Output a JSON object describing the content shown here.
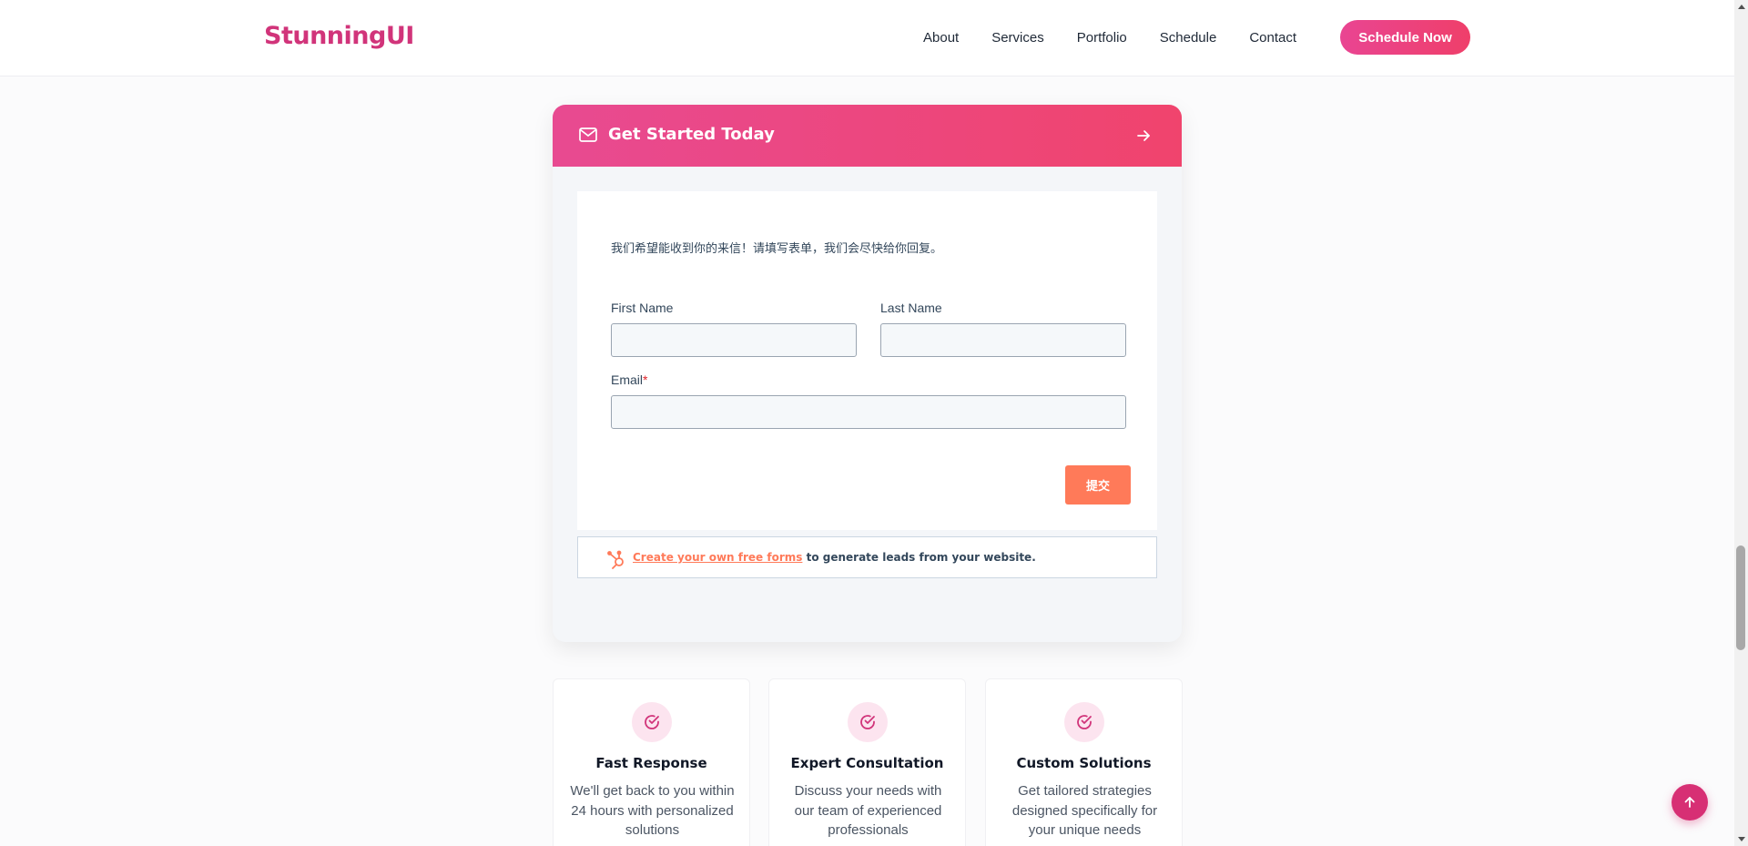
{
  "header": {
    "logo": "StunningUI",
    "nav": [
      "About",
      "Services",
      "Portfolio",
      "Schedule",
      "Contact"
    ],
    "cta_label": "Schedule Now"
  },
  "form_card": {
    "title": "Get Started Today",
    "icons": {
      "header": "mail-icon",
      "action": "arrow-right-icon"
    },
    "intro": "我们希望能收到你的来信！请填写表单，我们会尽快给你回复。",
    "fields": {
      "first_name": {
        "label": "First Name",
        "value": ""
      },
      "last_name": {
        "label": "Last Name",
        "value": ""
      },
      "email": {
        "label": "Email",
        "required_mark": "*",
        "value": ""
      }
    },
    "submit_label": "提交",
    "hubspot": {
      "link_text": "Create your own free forms",
      "suffix_text": " to generate leads from your website."
    }
  },
  "features": [
    {
      "title": "Fast Response",
      "description": "We'll get back to you within 24 hours with personalized solutions",
      "icon": "check-circle-icon"
    },
    {
      "title": "Expert Consultation",
      "description": "Discuss your needs with our team of experienced professionals",
      "icon": "check-circle-icon"
    },
    {
      "title": "Custom Solutions",
      "description": "Get tailored strategies designed specifically for your unique needs",
      "icon": "check-circle-icon"
    }
  ],
  "colors": {
    "brand": "#d1347a",
    "gradient_start": "#e84a91",
    "gradient_end": "#f0446d",
    "submit": "#ff7a59",
    "scroll_top": "#d72f74"
  }
}
